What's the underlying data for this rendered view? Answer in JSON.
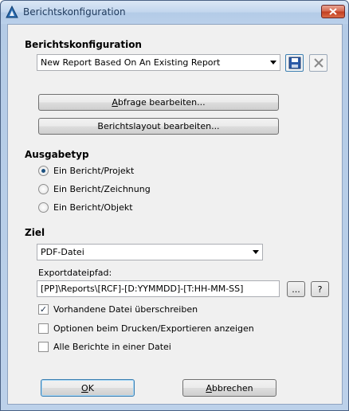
{
  "window": {
    "title": "Berichtskonfiguration"
  },
  "report_config": {
    "heading": "Berichtskonfiguration",
    "selected_report": "New Report Based On An Existing Report",
    "edit_query_label_pre": "",
    "edit_query_label_mnemonic": "A",
    "edit_query_label_post": "bfrage bearbeiten...",
    "edit_layout_label": "Berichtslayout bearbeiten..."
  },
  "output_type": {
    "heading": "Ausgabetyp",
    "options": [
      {
        "label": "Ein Bericht/Projekt",
        "selected": true
      },
      {
        "label": "Ein Bericht/Zeichnung",
        "selected": false
      },
      {
        "label": "Ein Bericht/Objekt",
        "selected": false
      }
    ]
  },
  "target": {
    "heading": "Ziel",
    "format_selected": "PDF-Datei",
    "export_path_label": "Exportdateipfad:",
    "export_path_value": "[PP]\\Reports\\[RCF]-[D:YYMMDD]-[T:HH-MM-SS]",
    "browse_label": "...",
    "help_label": "?",
    "checkboxes": [
      {
        "label": "Vorhandene Datei überschreiben",
        "checked": true
      },
      {
        "label": "Optionen beim Drucken/Exportieren anzeigen",
        "checked": false
      },
      {
        "label": "Alle Berichte in einer Datei",
        "checked": false
      }
    ]
  },
  "footer": {
    "ok_mnemonic": "O",
    "ok_rest": "K",
    "cancel_mnemonic": "A",
    "cancel_rest": "bbrechen"
  },
  "icons": {
    "app": "autocad-logo-icon",
    "close": "close-icon",
    "save": "floppy-disk-save-icon",
    "delete": "delete-x-icon",
    "check_glyph": "✓"
  },
  "colors": {
    "close_button": "#c13c1f",
    "title_text": "#1e395b",
    "save_icon": "#2b5aa8"
  }
}
